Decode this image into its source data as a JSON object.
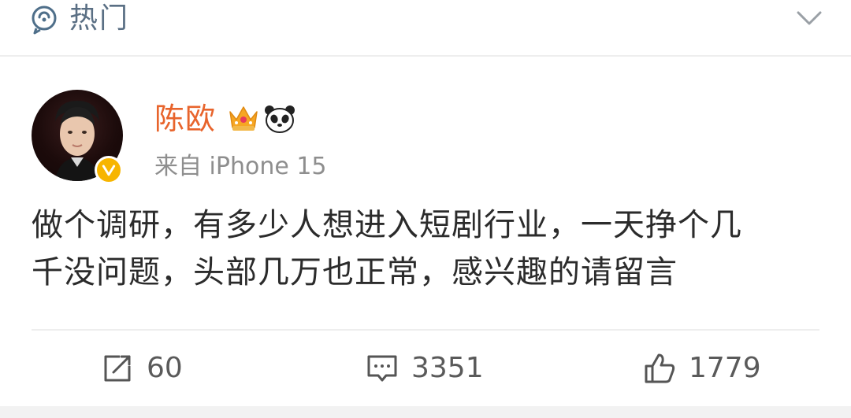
{
  "header": {
    "label": "热门",
    "icon": "hot-feed-icon",
    "chevron_icon": "chevron-down-icon"
  },
  "post": {
    "user_name": "陈欧",
    "badges": [
      "crown-icon",
      "panda-icon"
    ],
    "verified_icon": "verified-badge-icon",
    "source": "来自 iPhone 15",
    "text_lines": [
      "做个调研，有多少人想进入短剧行业，一天挣个几",
      "千没问题，头部几万也正常，感兴趣的请留言"
    ]
  },
  "actions": {
    "repost": {
      "icon": "repost-icon",
      "count": "60"
    },
    "comment": {
      "icon": "comment-icon",
      "count": "3351"
    },
    "like": {
      "icon": "like-icon",
      "count": "1779"
    }
  },
  "colors": {
    "name": "#e8642c",
    "header_text": "#5a6f84",
    "body_text": "#2b2b2b",
    "meta_text": "#8e8e8e",
    "verified": "#f7b500"
  }
}
